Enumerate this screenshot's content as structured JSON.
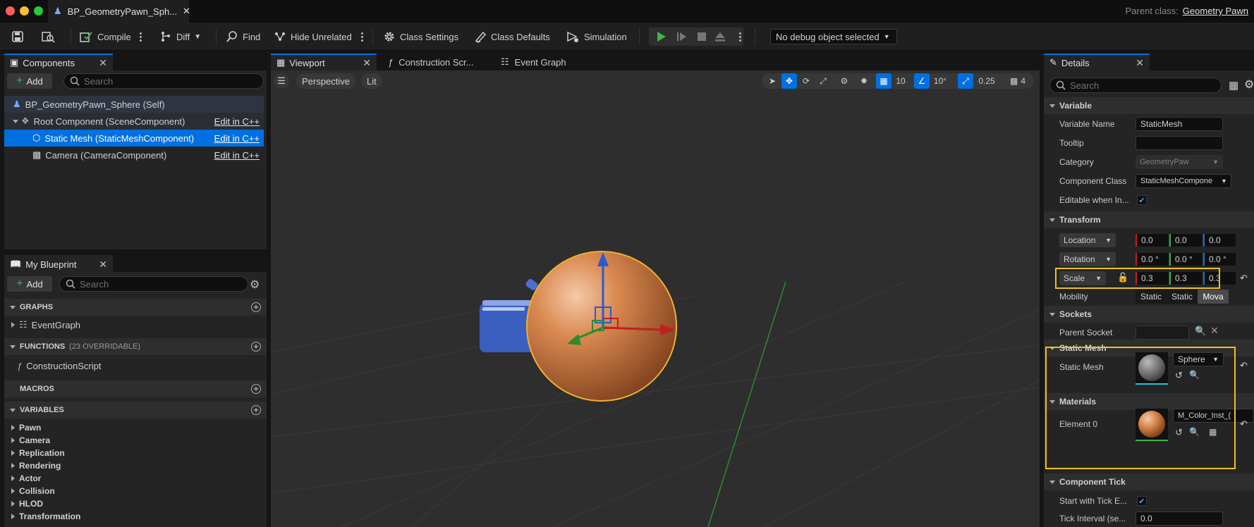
{
  "window": {
    "tab_title": "BP_GeometryPawn_Sph...",
    "parent_class_label": "Parent class:",
    "parent_class_value": "Geometry Pawn"
  },
  "toolbar": {
    "compile": "Compile",
    "diff": "Diff",
    "find": "Find",
    "hide_unrelated": "Hide Unrelated",
    "class_settings": "Class Settings",
    "class_defaults": "Class Defaults",
    "simulation": "Simulation",
    "debug_object": "No debug object selected"
  },
  "components": {
    "tab": "Components",
    "add": "Add",
    "search_placeholder": "Search",
    "items": [
      {
        "label": "BP_GeometryPawn_Sphere (Self)"
      },
      {
        "label": "Root Component (SceneComponent)",
        "edit": "Edit in C++"
      },
      {
        "label": "Static Mesh (StaticMeshComponent)",
        "edit": "Edit in C++"
      },
      {
        "label": "Camera (CameraComponent)",
        "edit": "Edit in C++"
      }
    ]
  },
  "my_blueprint": {
    "tab": "My Blueprint",
    "add": "Add",
    "search_placeholder": "Search",
    "graphs": "GRAPHS",
    "event_graph": "EventGraph",
    "functions": "FUNCTIONS",
    "functions_count": "(23 OVERRIDABLE)",
    "construction_script": "ConstructionScript",
    "macros": "MACROS",
    "variables": "VARIABLES",
    "variable_groups": [
      "Pawn",
      "Camera",
      "Replication",
      "Rendering",
      "Actor",
      "Collision",
      "HLOD",
      "Transformation"
    ]
  },
  "editor_tabs": {
    "viewport": "Viewport",
    "construction": "Construction Scr...",
    "event_graph": "Event Graph"
  },
  "viewport": {
    "perspective": "Perspective",
    "lit": "Lit",
    "grid_snap": "10",
    "rotation_snap": "10°",
    "scale_snap": "0.25",
    "camera_speed": "4"
  },
  "details": {
    "tab": "Details",
    "search_placeholder": "Search",
    "variable_section": "Variable",
    "variable_name_label": "Variable Name",
    "variable_name_value": "StaticMesh",
    "tooltip_label": "Tooltip",
    "tooltip_value": "",
    "category_label": "Category",
    "category_value": "GeometryPaw",
    "component_class_label": "Component Class",
    "component_class_value": "StaticMeshCompone",
    "editable_label": "Editable when In...",
    "transform_section": "Transform",
    "location_label": "Location",
    "location": [
      "0.0",
      "0.0",
      "0.0"
    ],
    "rotation_label": "Rotation",
    "rotation": [
      "0.0 °",
      "0.0 °",
      "0.0 °"
    ],
    "scale_label": "Scale",
    "scale": [
      "0.3",
      "0.3",
      "0.3"
    ],
    "mobility_label": "Mobility",
    "mobility_options": [
      "Static",
      "Static",
      "Mova"
    ],
    "sockets_section": "Sockets",
    "parent_socket_label": "Parent Socket",
    "static_mesh_section": "Static Mesh",
    "static_mesh_label": "Static Mesh",
    "static_mesh_value": "Sphere",
    "materials_section": "Materials",
    "element0_label": "Element 0",
    "element0_value": "M_Color_Inst_(",
    "component_tick_section": "Component Tick",
    "start_tick_label": "Start with Tick E...",
    "tick_interval_label": "Tick Interval (se...",
    "tick_interval_value": "0.0"
  },
  "colors": {
    "accent_blue": "#0070e0",
    "highlight_yellow": "#f0c020",
    "play_green": "#3cb44b",
    "sphere_orange": "#e08850"
  }
}
